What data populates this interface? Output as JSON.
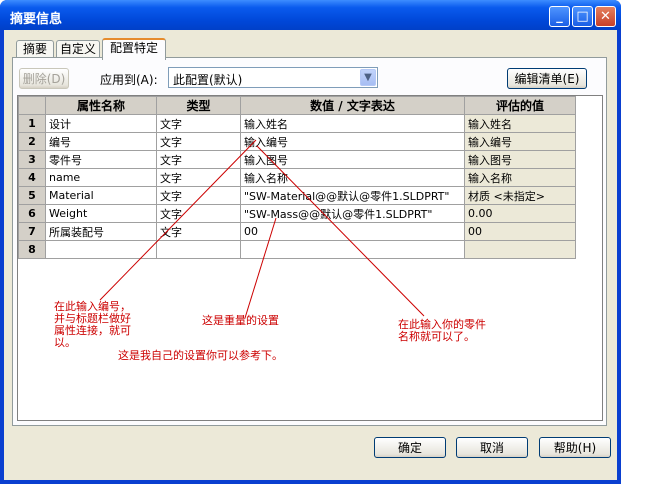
{
  "window": {
    "title": "摘要信息"
  },
  "titlebar_buttons": [
    {
      "name": "minimize-button",
      "glyph": "_"
    },
    {
      "name": "maximize-button",
      "glyph": "□"
    },
    {
      "name": "close-button",
      "glyph": "✕"
    }
  ],
  "tabs": [
    "摘要",
    "自定义",
    "配置特定"
  ],
  "toolbar": {
    "delete_label": "删除(D)",
    "apply_label": "应用到(A):",
    "apply_value": "此配置(默认)",
    "edit_list_label": "编辑清单(E)"
  },
  "table": {
    "headers": [
      "属性名称",
      "类型",
      "数值 / 文字表达",
      "评估的值"
    ],
    "rows": [
      {
        "num": "1",
        "name": "设计",
        "type": "文字",
        "value": "输入姓名",
        "eval": "输入姓名"
      },
      {
        "num": "2",
        "name": "编号",
        "type": "文字",
        "value": "输入编号",
        "eval": "输入编号"
      },
      {
        "num": "3",
        "name": "零件号",
        "type": "文字",
        "value": "输入图号",
        "eval": "输入图号"
      },
      {
        "num": "4",
        "name": "name",
        "type": "文字",
        "value": "输入名称",
        "eval": "输入名称"
      },
      {
        "num": "5",
        "name": "Material",
        "type": "文字",
        "value": "\"SW-Material@@默认@零件1.SLDPRT\"",
        "eval": "材质 <未指定>"
      },
      {
        "num": "6",
        "name": "Weight",
        "type": "文字",
        "value": "\"SW-Mass@@默认@零件1.SLDPRT\"",
        "eval": "0.00"
      },
      {
        "num": "7",
        "name": "所属装配号",
        "type": "文字",
        "value": "00",
        "eval": "00"
      },
      {
        "num": "8",
        "name": "",
        "type": "",
        "value": "",
        "eval": ""
      }
    ]
  },
  "annotations": {
    "note1": "在此输入编号，\n并与标题栏做好\n属性连接，就可\n以。",
    "note2": "这是重量的设置",
    "note3": "在此输入你的零件\n名称就可以了。",
    "note4": "这是我自己的设置你可以参考下。"
  },
  "footer": {
    "ok_label": "确定",
    "cancel_label": "取消",
    "help_label": "帮助(H)"
  },
  "colors": {
    "annotation": "#cc0000",
    "title_bar": "#0a5bee",
    "active_tab_accent": "#e68b2c"
  }
}
